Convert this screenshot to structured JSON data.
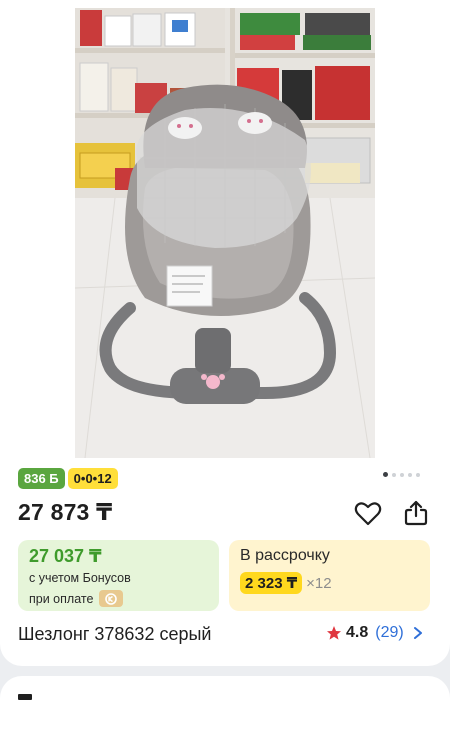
{
  "product": {
    "image_alt": "Baby swing lounger photo",
    "badges": {
      "bonus": "836 Б",
      "installment_plan": "0•0•12"
    },
    "price": "27 873 ₸",
    "bonus_offer": {
      "price": "27 037 ₸",
      "line1": "с учетом Бонусов",
      "line2": "при оплате"
    },
    "installment": {
      "label": "В рассрочку",
      "monthly": "2 323 ₸",
      "multiplier": "×12"
    },
    "title": "Шезлонг 378632 серый",
    "rating": {
      "score": "4.8",
      "count": "(29)"
    },
    "carousel": {
      "total_dots": 5,
      "active_index": 0
    }
  },
  "icons": {
    "favorite": "heart-icon",
    "share": "share-icon",
    "rating_star": "star-icon",
    "chevron": "chevron-right-icon",
    "payment": "kaspi-pay-icon"
  },
  "colors": {
    "bonus_green": "#5aa63f",
    "plan_yellow": "#ffdf3a",
    "star_red": "#e0363f",
    "link_blue": "#2f6fd8"
  }
}
